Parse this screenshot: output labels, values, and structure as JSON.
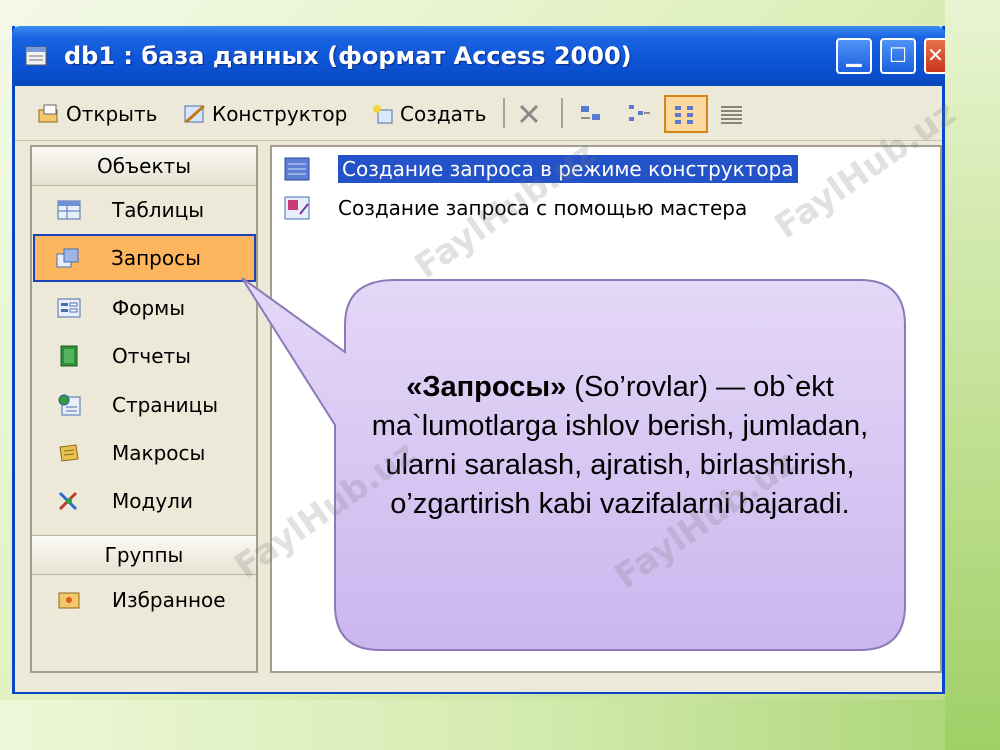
{
  "window": {
    "title": "db1 : база данных (формат Access 2000)",
    "controls": {
      "minimize": "minimize",
      "maximize": "maximize",
      "close": "close"
    }
  },
  "toolbar": {
    "open_label": "Открыть",
    "design_label": "Конструктор",
    "create_label": "Создать"
  },
  "objects": {
    "header": "Объекты",
    "items": [
      {
        "label": "Таблицы",
        "icon": "table-icon",
        "selected": false
      },
      {
        "label": "Запросы",
        "icon": "query-icon",
        "selected": true
      },
      {
        "label": "Формы",
        "icon": "form-icon",
        "selected": false
      },
      {
        "label": "Отчеты",
        "icon": "report-icon",
        "selected": false
      },
      {
        "label": "Страницы",
        "icon": "page-icon",
        "selected": false
      },
      {
        "label": "Макросы",
        "icon": "macro-icon",
        "selected": false
      },
      {
        "label": "Модули",
        "icon": "module-icon",
        "selected": false
      }
    ],
    "groups_header": "Группы",
    "groups": [
      {
        "label": "Избранное",
        "icon": "favorites-icon"
      }
    ]
  },
  "list": {
    "items": [
      {
        "label": "Создание запроса в режиме конструктора",
        "selected": true
      },
      {
        "label": "Создание запроса с помощью мастера",
        "selected": false
      }
    ]
  },
  "callout": {
    "bold": "«Запросы»",
    "text": " (So’rovlar) —  ob`ekt ma`lumotlarga ishlov berish, jumladan, ularni saralash, ajratish, birlashtirish, o’zgartirish  kabi vazifalarni bajaradi."
  },
  "watermark": "FaylHub.uz",
  "colors": {
    "titlebar": "#0c54d6",
    "selection": "#fdb55e",
    "list_selection": "#2452c9",
    "callout_fill": "#d8c8f2"
  }
}
